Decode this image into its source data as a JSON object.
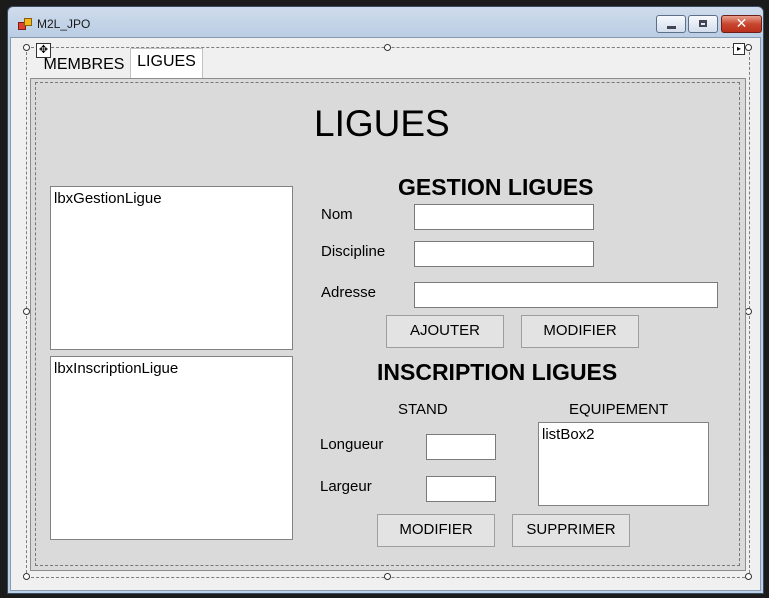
{
  "window": {
    "title": "M2L_JPO",
    "close_symbol": "✕"
  },
  "tabs": [
    {
      "label": "MEMBRES",
      "active": false
    },
    {
      "label": "LIGUES",
      "active": true
    }
  ],
  "page": {
    "title": "LIGUES",
    "gestion": {
      "heading": "GESTION LIGUES",
      "nom_label": "Nom",
      "nom_value": "",
      "discipline_label": "Discipline",
      "discipline_value": "",
      "adresse_label": "Adresse",
      "adresse_value": "",
      "ajouter_label": "AJOUTER",
      "modifier_label": "MODIFIER"
    },
    "inscription": {
      "heading": "INSCRIPTION LIGUES",
      "stand_label": "STAND",
      "equipement_label": "EQUIPEMENT",
      "longueur_label": "Longueur",
      "longueur_value": "",
      "largeur_label": "Largeur",
      "largeur_value": "",
      "modifier_label": "MODIFIER",
      "supprimer_label": "SUPPRIMER"
    },
    "lists": {
      "gestion": "lbxGestionLigue",
      "inscription": "lbxInscriptionLigue",
      "equipement": "listBox2"
    }
  },
  "colors": {
    "tab_page_bg": "#dadada",
    "client_bg": "#f0f0f0",
    "close_button": "#c8462f"
  }
}
